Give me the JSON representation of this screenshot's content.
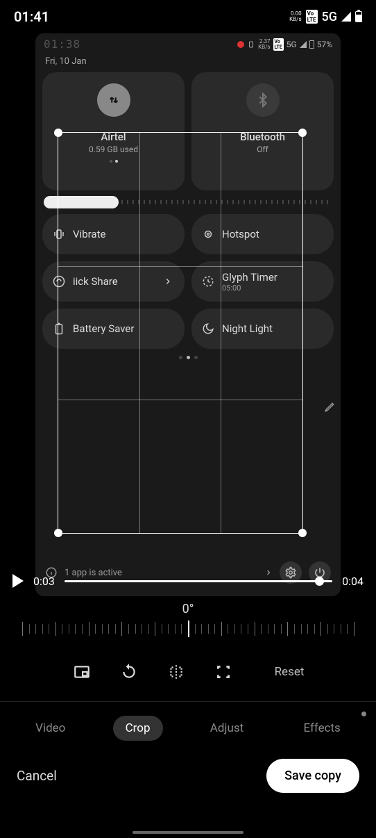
{
  "status": {
    "time": "01:41",
    "speed_val": "0.00",
    "speed_unit": "KB/s",
    "lte_badge": "Vo\nLTE",
    "network": "5G"
  },
  "inner": {
    "clock": "01:38",
    "date": "Fri, 10 Jan",
    "speed_right": "2.37",
    "speed_unit_right": "KB/s",
    "net": "5G",
    "batt_pct": "57%"
  },
  "tiles": {
    "data": {
      "title": "Airtel",
      "sub": "0.59 GB used"
    },
    "bt": {
      "title": "Bluetooth",
      "sub": "Off"
    }
  },
  "qs": {
    "vibrate": "Vibrate",
    "hotspot": "Hotspot",
    "quickshare": "iick Share",
    "glyph": {
      "title": "Glyph Timer",
      "sub": "05:00"
    },
    "battsaver": "Battery Saver",
    "nightlight": "Night Light"
  },
  "bottom_info": "1 app is active",
  "scrubber": {
    "current": "0:03",
    "total": "0:04"
  },
  "rotation_deg": "0°",
  "tools": {
    "reset": "Reset"
  },
  "tabs": {
    "video": "Video",
    "crop": "Crop",
    "adjust": "Adjust",
    "effects": "Effects"
  },
  "footer": {
    "cancel": "Cancel",
    "save": "Save copy"
  }
}
